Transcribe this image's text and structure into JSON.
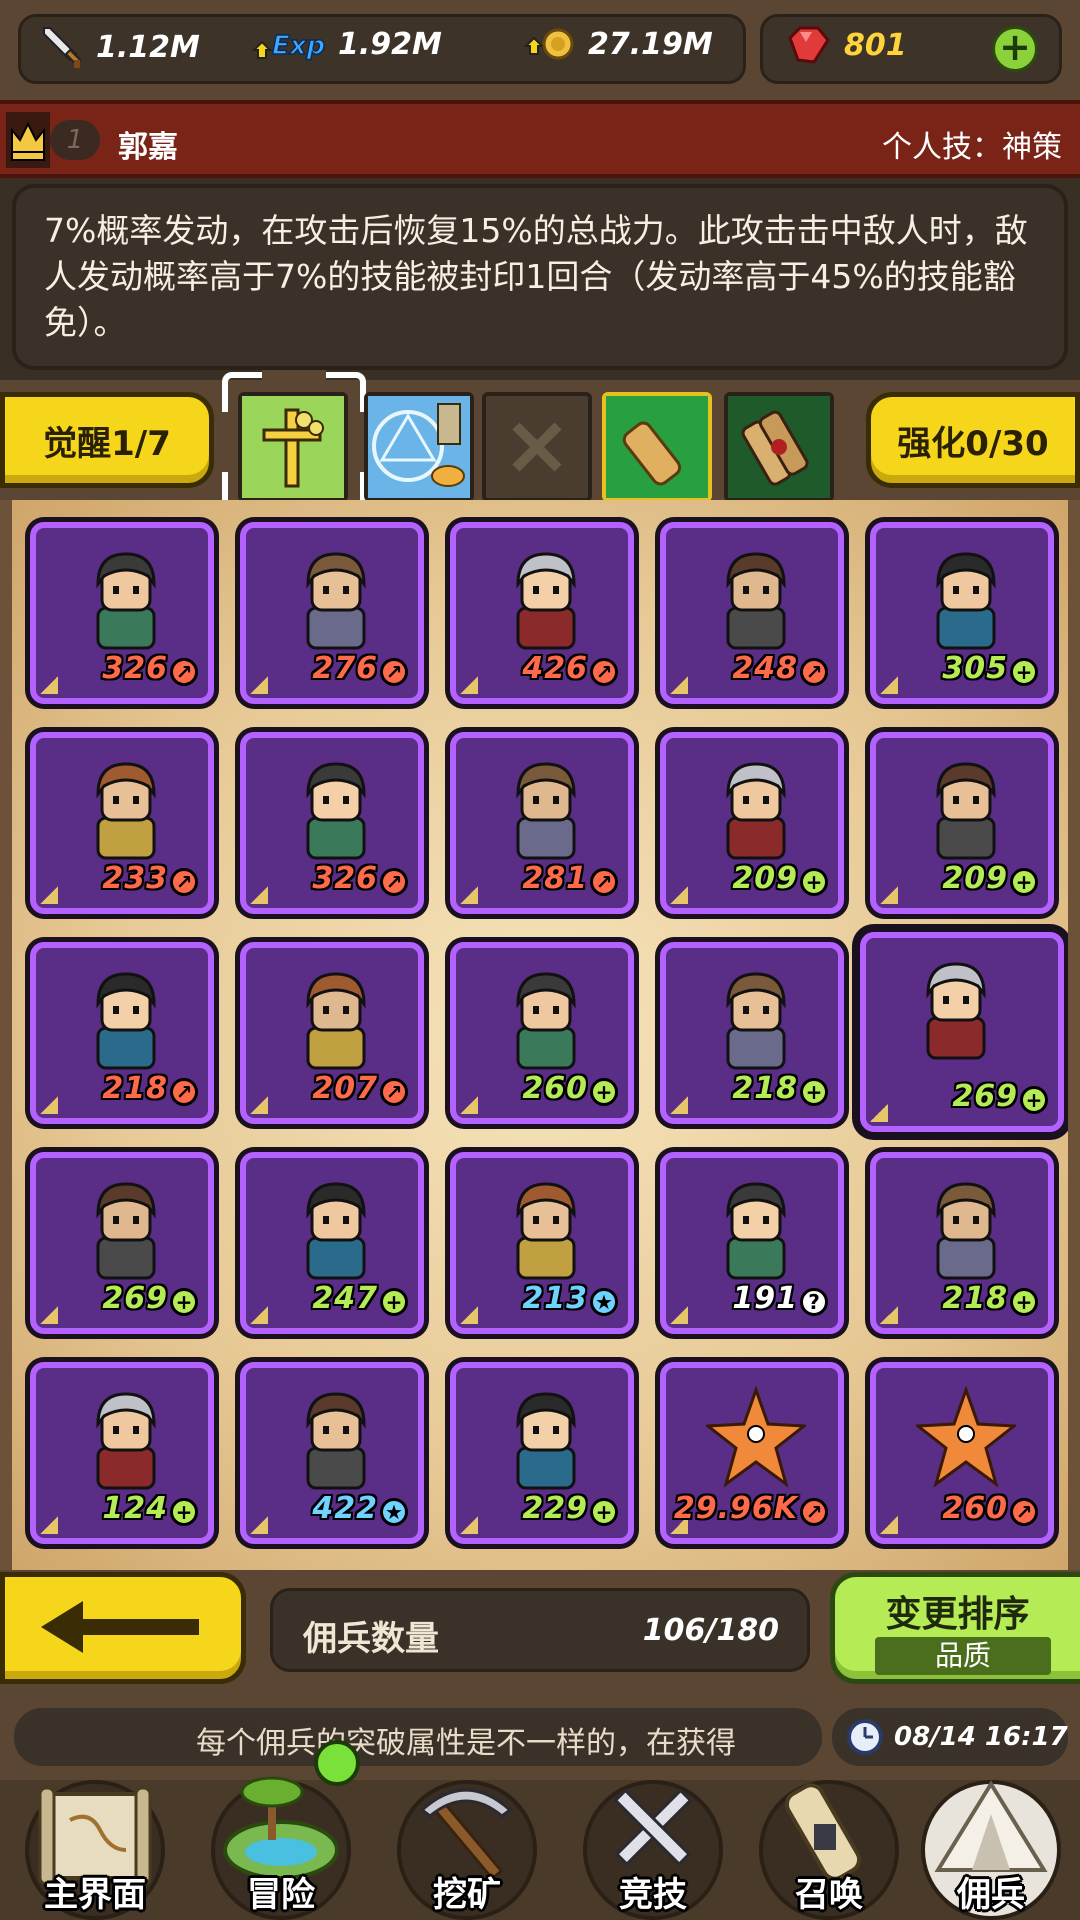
{
  "resources": {
    "attack": "1.12M",
    "exp": "1.92M",
    "gold": "27.19M",
    "gems": "801"
  },
  "hero": {
    "rank": "1",
    "name": "郭嘉",
    "skill_type": "个人技：神策",
    "description": "7%概率发动，在攻击后恢复15%的总战力。此攻击击中敌人时，敌人发动概率高于7%的技能被封印1回合（发动率高于45%的技能豁免）。"
  },
  "awaken": {
    "label": "觉醒1/7"
  },
  "enhance": {
    "label": "强化0/30"
  },
  "skill_slots": [
    "holy-staff-icon",
    "magic-circle-handshake-icon",
    "empty-slot-icon",
    "scroll-icon",
    "scroll-bundle-icon"
  ],
  "heroes": [
    {
      "power": "326",
      "badge": "arrow",
      "color": "#ff6a4a"
    },
    {
      "power": "276",
      "badge": "arrow",
      "color": "#ff6a4a"
    },
    {
      "power": "426",
      "badge": "arrow",
      "color": "#ff6a4a"
    },
    {
      "power": "248",
      "badge": "arrow",
      "color": "#ff6a4a"
    },
    {
      "power": "305",
      "badge": "plus",
      "color": "#b5ec56"
    },
    {
      "power": "233",
      "badge": "arrow",
      "color": "#ff6a4a"
    },
    {
      "power": "326",
      "badge": "arrow",
      "color": "#ff6a4a"
    },
    {
      "power": "281",
      "badge": "arrow",
      "color": "#ff6a4a"
    },
    {
      "power": "209",
      "badge": "plus",
      "color": "#b5ec56"
    },
    {
      "power": "209",
      "badge": "plus",
      "color": "#b5ec56"
    },
    {
      "power": "218",
      "badge": "arrow",
      "color": "#ff6a4a"
    },
    {
      "power": "207",
      "badge": "arrow",
      "color": "#ff6a4a"
    },
    {
      "power": "260",
      "badge": "plus",
      "color": "#b5ec56"
    },
    {
      "power": "218",
      "badge": "plus",
      "color": "#b5ec56"
    },
    {
      "power": "269",
      "badge": "plus",
      "color": "#b5ec56"
    },
    {
      "power": "269",
      "badge": "plus",
      "color": "#b5ec56"
    },
    {
      "power": "247",
      "badge": "plus",
      "color": "#b5ec56"
    },
    {
      "power": "213",
      "badge": "star",
      "color": "#6fd2ff"
    },
    {
      "power": "191",
      "badge": "question",
      "color": "#ffffff"
    },
    {
      "power": "218",
      "badge": "plus",
      "color": "#b5ec56"
    },
    {
      "power": "124",
      "badge": "plus",
      "color": "#b5ec56"
    },
    {
      "power": "422",
      "badge": "star",
      "color": "#6fd2ff"
    },
    {
      "power": "229",
      "badge": "plus",
      "color": "#b5ec56"
    },
    {
      "power": "29.96K",
      "badge": "arrow",
      "color": "#ff6a4a"
    },
    {
      "power": "260",
      "badge": "arrow",
      "color": "#ff6a4a"
    }
  ],
  "mercenary": {
    "count_label": "佣兵数量",
    "count_value": "106/180"
  },
  "sort": {
    "title": "变更排序",
    "mode": "品质"
  },
  "ticker": {
    "message": "每个佣兵的突破属性是不一样的，在获得",
    "time": "08/14 16:17"
  },
  "nav": [
    "主界面",
    "冒险",
    "挖矿",
    "竞技",
    "召唤",
    "佣兵"
  ]
}
